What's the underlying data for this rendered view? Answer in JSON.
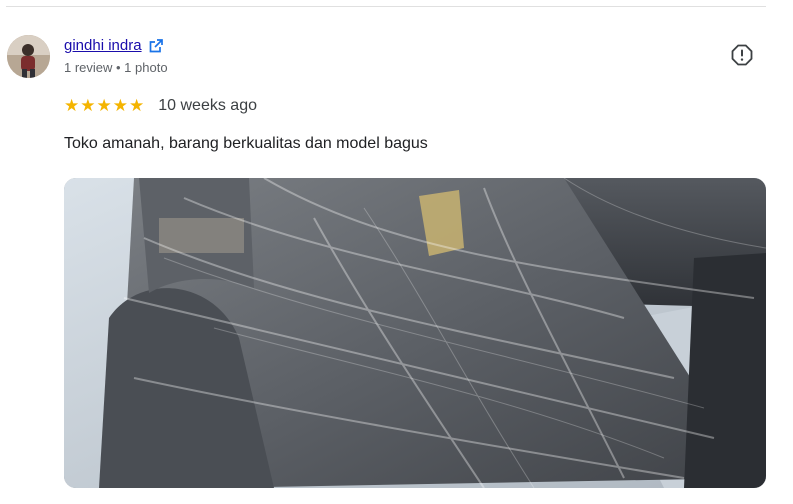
{
  "review": {
    "reviewer_name": "gindhi indra",
    "reviewer_meta": "1 review • 1 photo",
    "rating": 5,
    "stars": [
      "★",
      "★",
      "★",
      "★",
      "★"
    ],
    "date": "10 weeks ago",
    "text": "Toko amanah, barang berkualitas dan model bagus"
  },
  "icons": {
    "external_link": "external-link-icon",
    "flag": "report-flag-icon"
  },
  "colors": {
    "name_link": "#1a0dab",
    "star": "#f4b400",
    "meta": "#5f6368"
  }
}
